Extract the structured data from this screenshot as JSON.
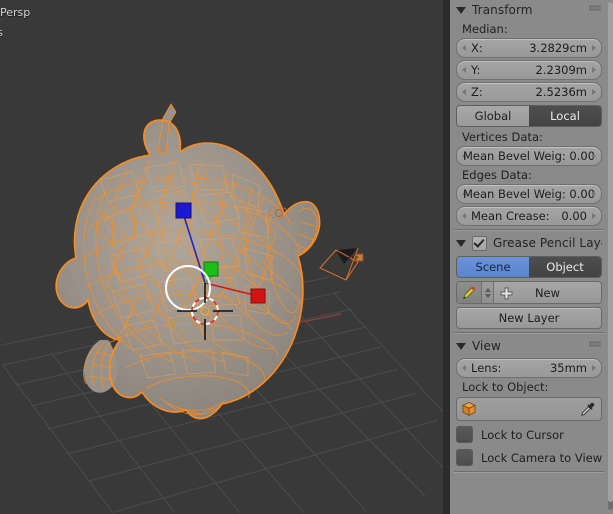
{
  "viewport": {
    "header_line_1": "r Persp",
    "header_line_2": "ers",
    "background_color": "#393939",
    "mesh_wire_color": "#ff8c1a",
    "mesh_surface_color": "#9a9289",
    "grid_color": "#4f4f4f",
    "axis_x_color": "#9e4242",
    "axis_y_color": "#3f7a3f",
    "manipulator": {
      "z_handle_color": "#2b2bd8",
      "y_handle_color": "#18c018",
      "x_handle_color": "#cc1a1a",
      "circle_color": "#ffffff"
    },
    "cursor_name": "3d-cursor"
  },
  "panel": {
    "transform": {
      "title": "Transform",
      "median_label": "Median:",
      "fields": [
        {
          "name": "X:",
          "value": "3.2829cm"
        },
        {
          "name": "Y:",
          "value": "2.2309m"
        },
        {
          "name": "Z:",
          "value": "2.5236m"
        }
      ],
      "space_toggle": {
        "global_label": "Global",
        "local_label": "Local",
        "selected": "Local"
      },
      "vertices_data_label": "Vertices Data:",
      "vertices_mean_bevel": "Mean Bevel Weig: 0.00",
      "edges_data_label": "Edges Data:",
      "edges_mean_bevel": "Mean Bevel Weig: 0.00",
      "edges_mean_crease_name": "Mean Crease:",
      "edges_mean_crease_value": "0.00"
    },
    "grease_pencil": {
      "title": "Grease Pencil Layers",
      "enabled": true,
      "source_toggle": {
        "scene_label": "Scene",
        "object_label": "Object",
        "selected": "Scene",
        "active_color": "#5f8cd4"
      },
      "new_label": "New",
      "new_layer_label": "New Layer"
    },
    "view": {
      "title": "View",
      "lens_name": "Lens:",
      "lens_value": "35mm",
      "lock_to_object_label": "Lock to Object:",
      "lock_to_object_value": "",
      "lock_to_cursor_label": "Lock to Cursor",
      "lock_to_cursor_checked": false,
      "lock_camera_label": "Lock Camera to View",
      "lock_camera_checked": false
    }
  }
}
